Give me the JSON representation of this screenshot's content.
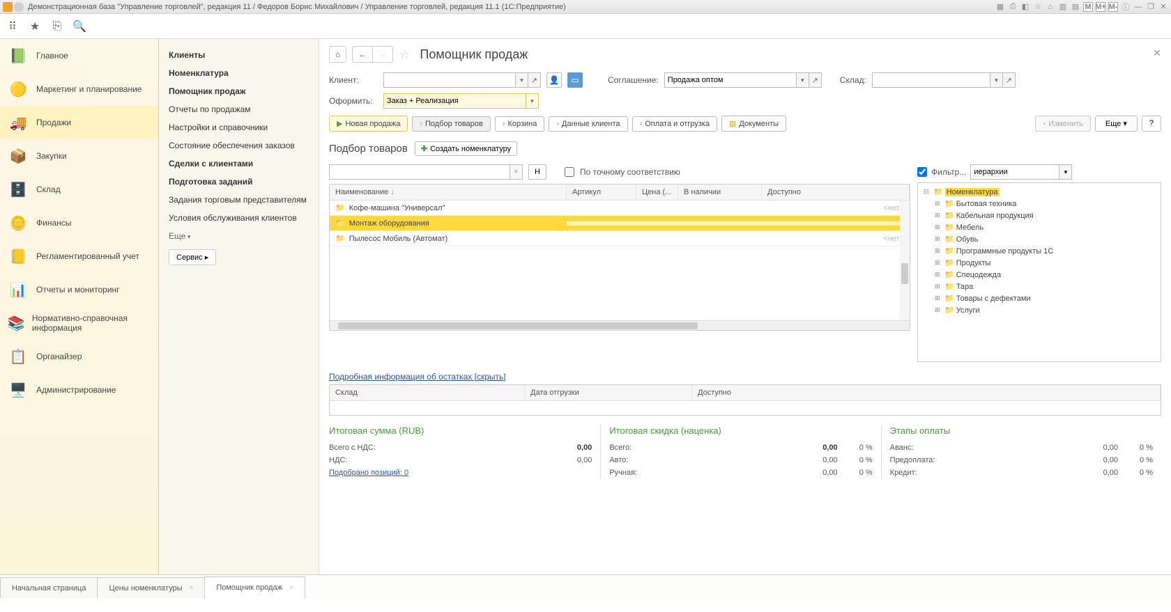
{
  "title": "Демонстрационная база \"Управление торговлей\", редакция 11 / Федоров Борис Михайлович / Управление торговлей, редакция 11.1  (1С:Предприятие)",
  "titlebar_icons": {
    "m": "M",
    "mp": "M+",
    "mm": "M-"
  },
  "nav": [
    {
      "label": "Главное"
    },
    {
      "label": "Маркетинг и планирование"
    },
    {
      "label": "Продажи"
    },
    {
      "label": "Закупки"
    },
    {
      "label": "Склад"
    },
    {
      "label": "Финансы"
    },
    {
      "label": "Регламентированный учет"
    },
    {
      "label": "Отчеты и мониторинг"
    },
    {
      "label": "Нормативно-справочная информация"
    },
    {
      "label": "Органайзер"
    },
    {
      "label": "Администрирование"
    }
  ],
  "sub": {
    "items": [
      {
        "label": "Клиенты",
        "bold": true
      },
      {
        "label": "Номенклатура",
        "bold": true
      },
      {
        "label": "Помощник продаж",
        "bold": true
      },
      {
        "label": "Отчеты по продажам"
      },
      {
        "label": "Настройки и справочники"
      },
      {
        "label": "Состояние обеспечения заказов"
      },
      {
        "label": "Сделки с клиентами",
        "bold": true
      },
      {
        "label": "Подготовка заданий",
        "bold": true
      },
      {
        "label": "Задания торговым представителям"
      },
      {
        "label": "Условия обслуживания клиентов"
      }
    ],
    "more": "Еще",
    "service": "Сервис ▸"
  },
  "page": {
    "title": "Помощник продаж",
    "fields": {
      "client": "Клиент:",
      "client_val": "",
      "agree": "Соглашение:",
      "agree_val": "Продажа оптом",
      "wh": "Склад:",
      "wh_val": "",
      "form": "Оформить:",
      "form_val": "Заказ + Реализация"
    },
    "steps": {
      "new": "Новая продажа",
      "sel": "Подбор товаров",
      "cart": "Корзина",
      "client": "Данные клиента",
      "pay": "Оплата и отгрузка",
      "docs": "Документы",
      "edit": "Изменить",
      "more": "Еще",
      "help": "?"
    },
    "section": {
      "title": "Подбор товаров",
      "create": "Создать номенклатуру"
    },
    "search": {
      "h": "Н",
      "exact": "По точному соответствию"
    },
    "table": {
      "cols": {
        "name": "Наименование",
        "art": "Артикул",
        "price": "Цена (...",
        "stock": "В наличии",
        "avail": "Доступно"
      },
      "rows": [
        {
          "name": "Кофе-машина \"Универсал\"",
          "avail": "<нет>"
        },
        {
          "name": "Монтаж оборудования",
          "avail": ""
        },
        {
          "name": "Пылесос Мобиль (Автомат)",
          "avail": "<нет>"
        }
      ]
    },
    "filter": {
      "label": "Фильтр...",
      "mode": "иерархии"
    },
    "tree": [
      {
        "label": "Номенклатура",
        "root": true
      },
      {
        "label": "Бытовая техника"
      },
      {
        "label": "Кабельная продукция"
      },
      {
        "label": "Мебель"
      },
      {
        "label": "Обувь"
      },
      {
        "label": "Программные продукты 1С"
      },
      {
        "label": "Продукты"
      },
      {
        "label": "Спецодежда"
      },
      {
        "label": "Тара"
      },
      {
        "label": "Товары с дефектами"
      },
      {
        "label": "Услуги"
      }
    ],
    "details_link": "Подробная информация об остатках [скрыть]",
    "table2": {
      "wh": "Склад",
      "ship": "Дата отгрузки",
      "avail": "Доступно"
    },
    "totals": {
      "sum": {
        "title": "Итоговая сумма (RUB)",
        "total": "Всего с НДС:",
        "total_v": "0,00",
        "vat": "НДС:",
        "vat_v": "0,00",
        "pos": "Подобрано позиций: 0"
      },
      "disc": {
        "title": "Итоговая скидка (наценка)",
        "total": "Всего:",
        "total_v": "0,00",
        "total_p": "0 %",
        "auto": "Авто:",
        "auto_v": "0,00",
        "auto_p": "0 %",
        "man": "Ручная:",
        "man_v": "0,00",
        "man_p": "0 %"
      },
      "pay": {
        "title": "Этапы оплаты",
        "adv": "Аванс:",
        "adv_v": "0,00",
        "adv_p": "0 %",
        "pre": "Предоплата:",
        "pre_v": "0,00",
        "pre_p": "0 %",
        "cr": "Кредит:",
        "cr_v": "0,00",
        "cr_p": "0 %"
      }
    }
  },
  "tabs": [
    {
      "label": "Начальная страница",
      "close": false
    },
    {
      "label": "Цены номенклатуры",
      "close": true
    },
    {
      "label": "Помощник продаж",
      "close": true,
      "active": true
    }
  ]
}
